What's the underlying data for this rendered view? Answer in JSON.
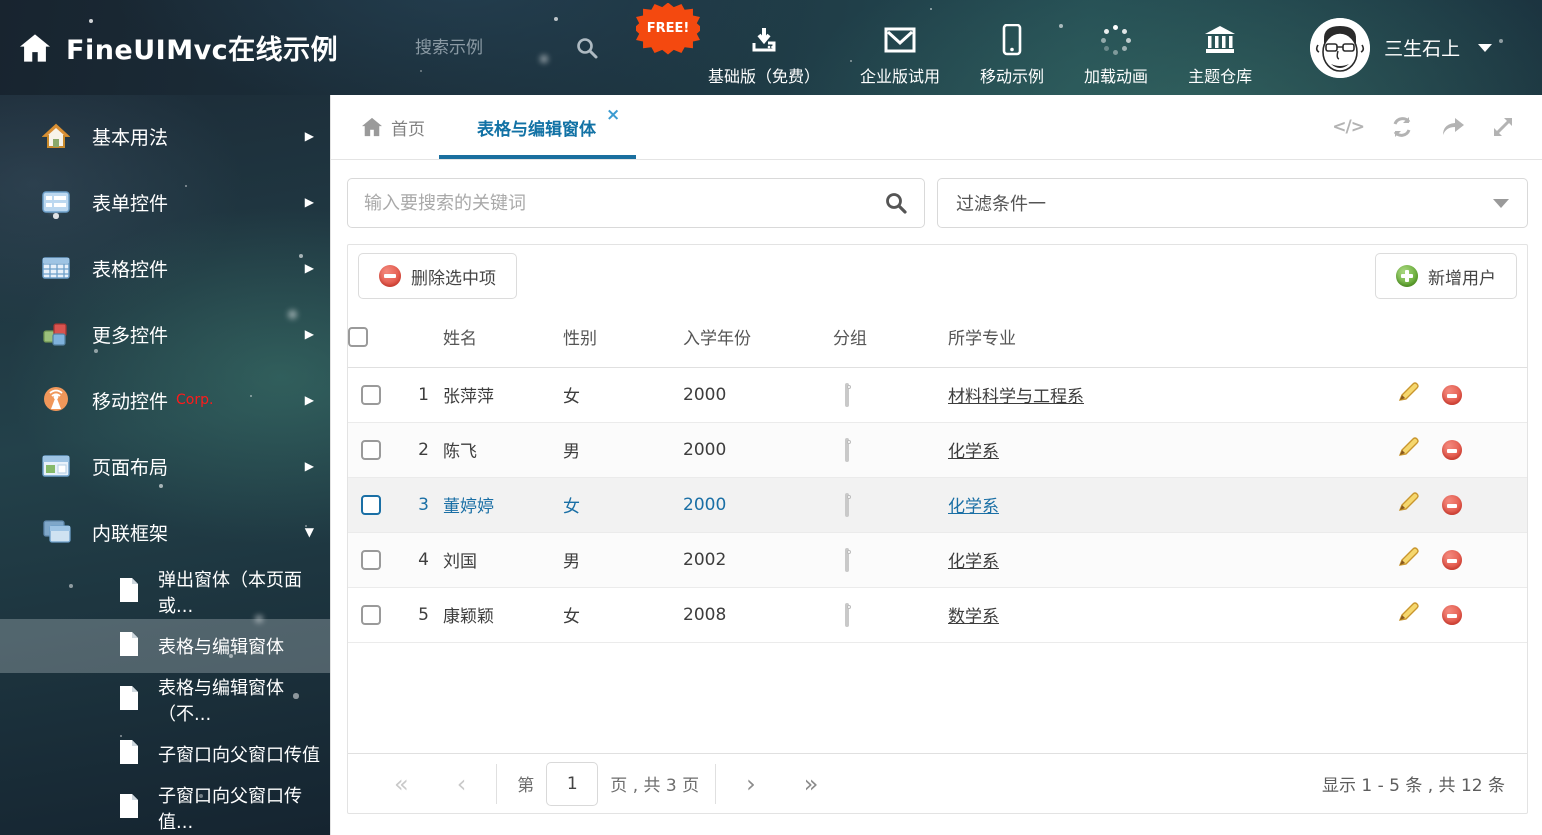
{
  "colors": {
    "accent_blue": "#1a6fa5",
    "header_dark": "#1d3440",
    "free_badge": "#f4490f",
    "delete_red": "#e3574a",
    "add_green": "#67ab37",
    "tag_blue": "#7fc0ee",
    "tag_green": "#8bbf55",
    "tag_orange": "#f8ab62",
    "corp_red": "#ff1a1a"
  },
  "icons": {
    "logo": "home-icon",
    "header_search": "magnifier-icon",
    "nav": [
      "download-icon",
      "envelope-icon",
      "mobile-phone-icon",
      "spinner-icon",
      "bank-icon"
    ],
    "tab_tools": [
      "code-icon",
      "refresh-icon",
      "share-icon",
      "expand-icon"
    ],
    "row_actions": [
      "pencil-icon",
      "delete-icon"
    ],
    "group_tag": "tag-icon"
  },
  "header": {
    "logo_title": "FineUIMvc在线示例",
    "search_placeholder": "搜索示例",
    "free_badge": "FREE!",
    "nav": [
      {
        "label": "基础版（免费）"
      },
      {
        "label": "企业版试用"
      },
      {
        "label": "移动示例"
      },
      {
        "label": "加载动画"
      },
      {
        "label": "主题仓库"
      }
    ],
    "username": "三生石上"
  },
  "sidebar": {
    "items": [
      {
        "label": "基本用法"
      },
      {
        "label": "表单控件"
      },
      {
        "label": "表格控件"
      },
      {
        "label": "更多控件"
      },
      {
        "label": "移动控件",
        "badge": "Corp."
      },
      {
        "label": "页面布局"
      },
      {
        "label": "内联框架",
        "expanded": true
      }
    ],
    "subitems": [
      {
        "label": "弹出窗体（本页面或..."
      },
      {
        "label": "表格与编辑窗体",
        "active": true
      },
      {
        "label": "表格与编辑窗体（不..."
      },
      {
        "label": "子窗口向父窗口传值"
      },
      {
        "label": "子窗口向父窗口传值..."
      }
    ]
  },
  "tabs": {
    "home": "首页",
    "active": "表格与编辑窗体",
    "close_glyph": "×"
  },
  "filter": {
    "search_placeholder": "输入要搜索的关键词",
    "combo_value": "过滤条件一"
  },
  "toolbar": {
    "delete_label": "删除选中项",
    "add_label": "新增用户"
  },
  "table": {
    "columns": {
      "name": "姓名",
      "gender": "性别",
      "year": "入学年份",
      "group": "分组",
      "major": "所学专业"
    },
    "rows": [
      {
        "index": "1",
        "name": "张萍萍",
        "gender": "女",
        "year": "2000",
        "tag_color": "#7fc0ee",
        "major": "材料科学与工程系",
        "selected": false
      },
      {
        "index": "2",
        "name": "陈飞",
        "gender": "男",
        "year": "2000",
        "tag_color": "#7fc0ee",
        "major": "化学系",
        "selected": false
      },
      {
        "index": "3",
        "name": "董婷婷",
        "gender": "女",
        "year": "2000",
        "tag_color": "#8bbf55",
        "major": "化学系",
        "selected": true
      },
      {
        "index": "4",
        "name": "刘国",
        "gender": "男",
        "year": "2002",
        "tag_color": "#8bbf55",
        "major": "化学系",
        "selected": false
      },
      {
        "index": "5",
        "name": "康颖颖",
        "gender": "女",
        "year": "2008",
        "tag_color": "#f8ab62",
        "major": "数学系",
        "selected": false
      }
    ]
  },
  "pagination": {
    "first_glyph": "«",
    "prev_glyph": "‹",
    "next_glyph": "›",
    "last_glyph": "»",
    "page_prefix": "第",
    "page_value": "1",
    "page_suffix": "页 , 共 3 页",
    "summary": "显示 1 - 5 条 , 共 12 条"
  }
}
